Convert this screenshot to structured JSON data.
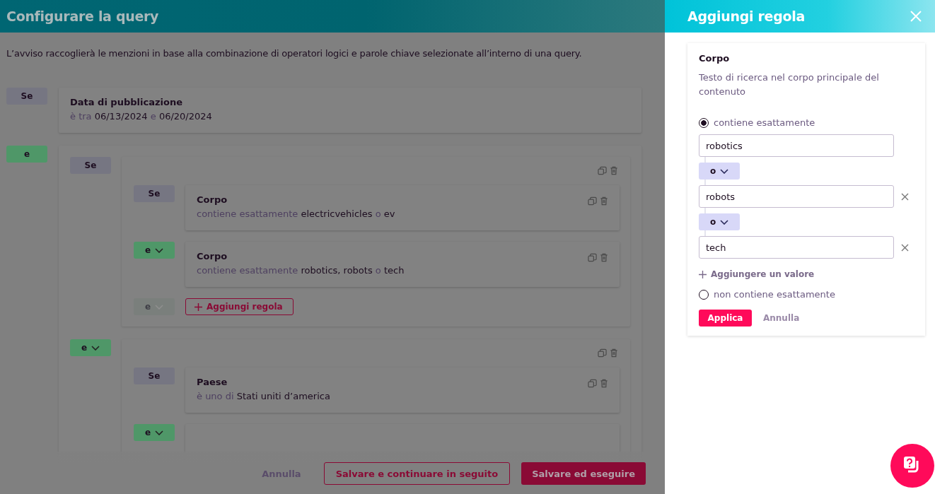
{
  "page": {
    "title": "Configurare la query",
    "description": "L’avviso raccoglierà le menzioni in base alla combinazione di operatori logici e parole chiave selezionate all’interno di una query.",
    "rules": [
      {
        "connector": {
          "label": "Se",
          "kind": "if",
          "dropdown": false,
          "disabled": false
        },
        "kind": "rule",
        "title": "Data di pubblicazione",
        "actions": false,
        "condition": [
          {
            "text": "è tra",
            "kind": "op"
          },
          {
            "text": "06/13/2024",
            "kind": "value"
          },
          {
            "text": "e",
            "kind": "op"
          },
          {
            "text": "06/20/2024",
            "kind": "value"
          }
        ]
      },
      {
        "connector": {
          "label": "e",
          "kind": "and",
          "dropdown": false,
          "disabled": false
        },
        "kind": "group",
        "children": [
          {
            "connector": {
              "label": "Se",
              "kind": "if",
              "dropdown": false,
              "disabled": false
            },
            "kind": "group",
            "children": [
              {
                "connector": {
                  "label": "Se",
                  "kind": "if",
                  "dropdown": false,
                  "disabled": false
                },
                "kind": "rule",
                "title": "Corpo",
                "actions": true,
                "condition": [
                  {
                    "text": "contiene esattamente",
                    "kind": "op"
                  },
                  {
                    "text": "electricvehicles",
                    "kind": "value"
                  },
                  {
                    "text": "o",
                    "kind": "op"
                  },
                  {
                    "text": "ev",
                    "kind": "value"
                  }
                ]
              },
              {
                "connector": {
                  "label": "e",
                  "kind": "and",
                  "dropdown": true,
                  "disabled": false
                },
                "kind": "rule",
                "title": "Corpo",
                "actions": true,
                "condition": [
                  {
                    "text": "contiene esattamente",
                    "kind": "op"
                  },
                  {
                    "text": "robotics,",
                    "kind": "value"
                  },
                  {
                    "text": "robots",
                    "kind": "value"
                  },
                  {
                    "text": "o",
                    "kind": "op"
                  },
                  {
                    "text": "tech",
                    "kind": "value"
                  }
                ]
              }
            ],
            "add": {
              "connector": {
                "label": "e",
                "kind": "and",
                "dropdown": true,
                "disabled": true
              },
              "label": "Aggiungi regola"
            }
          },
          {
            "connector": {
              "label": "e",
              "kind": "and",
              "dropdown": true,
              "disabled": false
            },
            "kind": "group",
            "children": [
              {
                "connector": {
                  "label": "Se",
                  "kind": "if",
                  "dropdown": false,
                  "disabled": false
                },
                "kind": "rule",
                "title": "Paese",
                "actions": true,
                "condition": [
                  {
                    "text": "è uno di",
                    "kind": "op"
                  },
                  {
                    "text": "Stati uniti d’america",
                    "kind": "value"
                  }
                ]
              },
              {
                "connector": {
                  "label": "e",
                  "kind": "and",
                  "dropdown": true,
                  "disabled": false
                },
                "kind": "rule",
                "actions": false
              }
            ]
          }
        ]
      }
    ],
    "footer": {
      "cancel": "Annulla",
      "save_later": "Salvare e continuare in seguito",
      "save_run": "Salvare ed eseguire"
    }
  },
  "panel": {
    "title": "Aggiungi regola",
    "card": {
      "title": "Corpo",
      "description": "Testo di ricerca nel corpo principale del contenuto",
      "options": [
        {
          "label": "contiene esattamente",
          "selected": true,
          "values": [
            {
              "value": "robotics",
              "removable": false
            },
            {
              "connector": "o",
              "value": "robots",
              "removable": true
            },
            {
              "connector": "o",
              "value": "tech",
              "removable": true
            }
          ],
          "add_value": "Aggiungere un valore"
        },
        {
          "label": "non contiene esattamente",
          "selected": false
        }
      ],
      "apply": "Applica",
      "cancel": "Annulla"
    }
  }
}
